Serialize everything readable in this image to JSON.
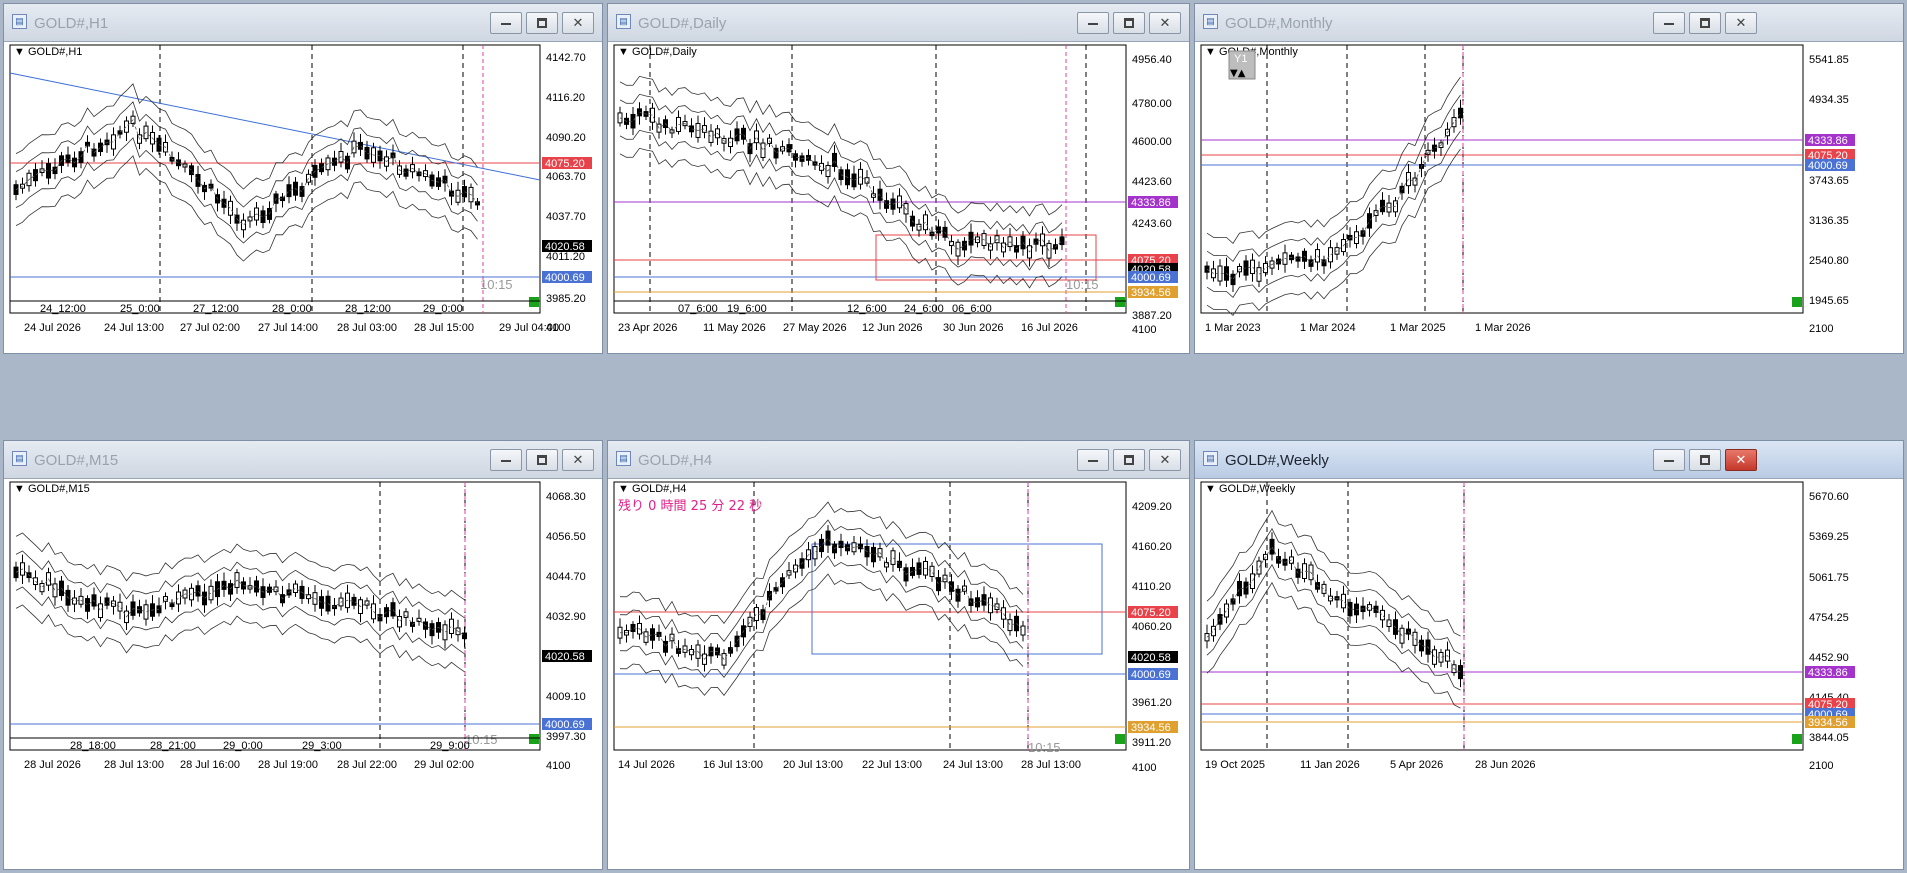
{
  "windows": [
    {
      "id": "h1",
      "title": "GOLD#,H1",
      "symbol_label": "GOLD#,H1",
      "prices": [
        "4142.70",
        "4116.20",
        "4090.20",
        "4063.70",
        "4037.70",
        "4011.20",
        "3985.20",
        "4100"
      ],
      "tags": [
        {
          "text": "4075.20",
          "color": "#e8434a"
        },
        {
          "text": "4020.58",
          "color": "#000000"
        },
        {
          "text": "4000.69",
          "color": "#4a72d4"
        }
      ],
      "time_labels": [
        "24_12:00",
        "25_0:00",
        "27_12:00",
        "28_0:00",
        "28_12:00",
        "29_0:00"
      ],
      "date_labels": [
        "24 Jul 2026",
        "24 Jul 13:00",
        "27 Jul 02:00",
        "27 Jul 14:00",
        "28 Jul 03:00",
        "28 Jul 15:00",
        "29 Jul 04:00"
      ],
      "countdown": "10:15"
    },
    {
      "id": "daily",
      "title": "GOLD#,Daily",
      "symbol_label": "GOLD#,Daily",
      "prices": [
        "4956.40",
        "4780.00",
        "4600.00",
        "4423.60",
        "4243.60",
        "3887.20",
        "4100"
      ],
      "tags": [
        {
          "text": "4333.86",
          "color": "#a433cc"
        },
        {
          "text": "4075.20",
          "color": "#e8434a"
        },
        {
          "text": "4020.58",
          "color": "#000000"
        },
        {
          "text": "4000.69",
          "color": "#4a72d4"
        },
        {
          "text": "3934.56",
          "color": "#e0a030"
        }
      ],
      "time_labels": [
        "07_6:00",
        "19_6:00",
        "12_6:00",
        "24_6:00",
        "06_6:00"
      ],
      "date_labels": [
        "23 Apr 2026",
        "11 May 2026",
        "27 May 2026",
        "12 Jun 2026",
        "30 Jun 2026",
        "16 Jul 2026"
      ],
      "countdown": "10:15"
    },
    {
      "id": "monthly",
      "title": "GOLD#,Monthly",
      "symbol_label": "GOLD#,Monthly",
      "badge": "Y1",
      "prices": [
        "5541.85",
        "4934.35",
        "3743.65",
        "3136.35",
        "2540.80",
        "1945.65",
        "2100"
      ],
      "tags": [
        {
          "text": "4333.86",
          "color": "#a433cc"
        },
        {
          "text": "4075.20",
          "color": "#e8434a"
        },
        {
          "text": "4000.69",
          "color": "#4a72d4"
        }
      ],
      "date_labels": [
        "1 Mar 2023",
        "1 Mar 2024",
        "1 Mar 2025",
        "1 Mar 2026"
      ]
    },
    {
      "id": "m15",
      "title": "GOLD#,M15",
      "symbol_label": "GOLD#,M15",
      "prices": [
        "4068.30",
        "4056.50",
        "4044.70",
        "4032.90",
        "4009.10",
        "3997.30",
        "4100"
      ],
      "tags": [
        {
          "text": "4020.58",
          "color": "#000000"
        },
        {
          "text": "4000.69",
          "color": "#4a72d4"
        }
      ],
      "time_labels": [
        "28_18:00",
        "28_21:00",
        "29_0:00",
        "29_3:00",
        "29_9:00"
      ],
      "date_labels": [
        "28 Jul 2026",
        "28 Jul 13:00",
        "28 Jul 16:00",
        "28 Jul 19:00",
        "28 Jul 22:00",
        "29 Jul 02:00"
      ],
      "countdown": "10:15"
    },
    {
      "id": "h4",
      "title": "GOLD#,H4",
      "symbol_label": "GOLD#,H4",
      "remaining": "残り 0 時間 25 分 22 秒",
      "prices": [
        "4209.20",
        "4160.20",
        "4110.20",
        "4060.20",
        "3961.20",
        "3911.20",
        "4100"
      ],
      "tags": [
        {
          "text": "4075.20",
          "color": "#e8434a"
        },
        {
          "text": "4020.58",
          "color": "#000000"
        },
        {
          "text": "4000.69",
          "color": "#4a72d4"
        },
        {
          "text": "3934.56",
          "color": "#e0a030"
        }
      ],
      "date_labels": [
        "14 Jul 2026",
        "16 Jul 13:00",
        "20 Jul 13:00",
        "22 Jul 13:00",
        "24 Jul 13:00",
        "28 Jul 13:00"
      ],
      "countdown": "10:15"
    },
    {
      "id": "weekly",
      "title": "GOLD#,Weekly",
      "symbol_label": "GOLD#,Weekly",
      "prices": [
        "5670.60",
        "5369.25",
        "5061.75",
        "4754.25",
        "4452.90",
        "4145.40",
        "3844.05",
        "2100"
      ],
      "tags": [
        {
          "text": "4333.86",
          "color": "#a433cc"
        },
        {
          "text": "4075.20",
          "color": "#e8434a"
        },
        {
          "text": "4000.69",
          "color": "#4a72d4"
        },
        {
          "text": "3934.56",
          "color": "#e0a030"
        }
      ],
      "date_labels": [
        "19 Oct 2025",
        "11 Jan 2026",
        "5 Apr 2026",
        "28 Jun 2026"
      ]
    }
  ],
  "colors": {
    "up": "#ffffff",
    "down": "#000000",
    "grid": "#000000",
    "bb": "#222222",
    "cursor": "#e040a0"
  }
}
